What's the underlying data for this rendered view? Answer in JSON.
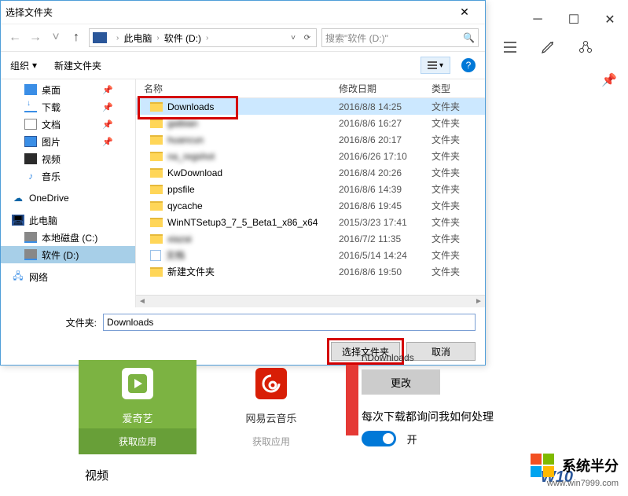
{
  "dialog": {
    "title": "选择文件夹",
    "breadcrumb": {
      "root": "此电脑",
      "drive": "软件 (D:)"
    },
    "search_placeholder": "搜索\"软件 (D:)\"",
    "toolbar": {
      "organize": "组织",
      "new_folder": "新建文件夹"
    },
    "headers": {
      "name": "名称",
      "date": "修改日期",
      "type": "类型"
    },
    "sidebar": [
      {
        "label": "桌面",
        "icon": "desktop",
        "pin": "📌"
      },
      {
        "label": "下载",
        "icon": "download",
        "pin": "📌"
      },
      {
        "label": "文档",
        "icon": "doc",
        "pin": "📌"
      },
      {
        "label": "图片",
        "icon": "pic",
        "pin": "📌"
      },
      {
        "label": "视频",
        "icon": "vid"
      },
      {
        "label": "音乐",
        "icon": "music"
      }
    ],
    "sidebar_groups": {
      "onedrive": "OneDrive",
      "pc": "此电脑",
      "hdd_c": "本地磁盘 (C:)",
      "hdd_d": "软件 (D:)",
      "network": "网络"
    },
    "files": [
      {
        "name": "Downloads",
        "date": "2016/8/8 14:25",
        "type": "文件夹",
        "selected": true
      },
      {
        "name": "gaibian",
        "date": "2016/8/6 16:27",
        "type": "文件夹",
        "blur": true
      },
      {
        "name": "huancun",
        "date": "2016/8/6 20:17",
        "type": "文件夹",
        "blur": true
      },
      {
        "name": "na_regshot",
        "date": "2016/6/26 17:10",
        "type": "文件夹",
        "blurName": true
      },
      {
        "name": "KwDownload",
        "date": "2016/8/4 20:26",
        "type": "文件夹"
      },
      {
        "name": "ppsfile",
        "date": "2016/8/6 14:39",
        "type": "文件夹"
      },
      {
        "name": "qycache",
        "date": "2016/8/6 19:45",
        "type": "文件夹"
      },
      {
        "name": "WinNTSetup3_7_5_Beta1_x86_x64",
        "date": "2015/3/23 17:41",
        "type": "文件夹"
      },
      {
        "name": "xiazai",
        "date": "2016/7/2 11:35",
        "type": "文件夹",
        "blur": true
      },
      {
        "name": "文档",
        "date": "2016/5/14 14:24",
        "type": "文件夹",
        "docIcon": true,
        "blurName": true
      },
      {
        "name": "新建文件夹",
        "date": "2016/8/6 19:50",
        "type": "文件夹"
      }
    ],
    "folder_label": "文件夹:",
    "folder_value": "Downloads",
    "btn_select": "选择文件夹",
    "btn_cancel": "取消"
  },
  "under": {
    "iqiyi": {
      "name": "爱奇艺",
      "get": "获取应用"
    },
    "netease": {
      "name": "网易云音乐",
      "get": "获取应用"
    }
  },
  "settings": {
    "path_suffix": "r\\Downloads",
    "change": "更改",
    "ask_label": "每次下载都询问我如何处理",
    "toggle_state": "开"
  },
  "bottom_label": "视频",
  "watermark": {
    "text": "系统半分",
    "url": "www.win7999.com",
    "w10": "W10"
  }
}
